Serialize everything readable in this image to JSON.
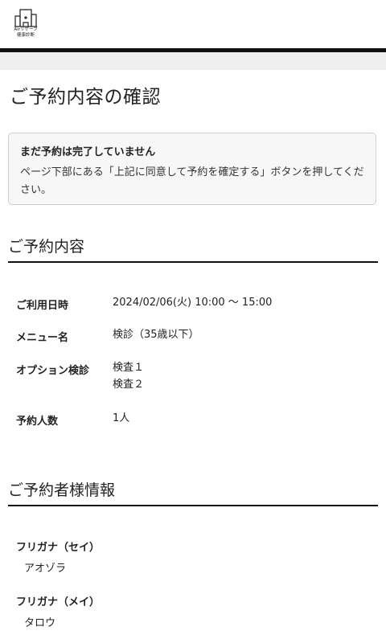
{
  "header": {
    "logo_line1": "Airリザーブ",
    "logo_line2": "健康診断"
  },
  "page_title": "ご予約内容の確認",
  "notice": {
    "title": "まだ予約は完了していません",
    "text": "ページ下部にある「上記に同意して予約を確定する」ボタンを押してください。"
  },
  "reservation": {
    "section_title": "ご予約内容",
    "rows": [
      {
        "label": "ご利用日時",
        "values": [
          "2024/02/06(火) 10:00 〜 15:00"
        ]
      },
      {
        "label": "メニュー名",
        "values": [
          "検診（35歳以下）"
        ]
      },
      {
        "label": "オプション検診",
        "values": [
          "検査１",
          "検査２"
        ]
      },
      {
        "label": "予約人数",
        "values": [
          "1人"
        ]
      }
    ]
  },
  "booker": {
    "section_title": "ご予約者様情報",
    "fields": [
      {
        "label": "フリガナ（セイ）",
        "value": "アオゾラ"
      },
      {
        "label": "フリガナ（メイ）",
        "value": "タロウ"
      }
    ]
  }
}
